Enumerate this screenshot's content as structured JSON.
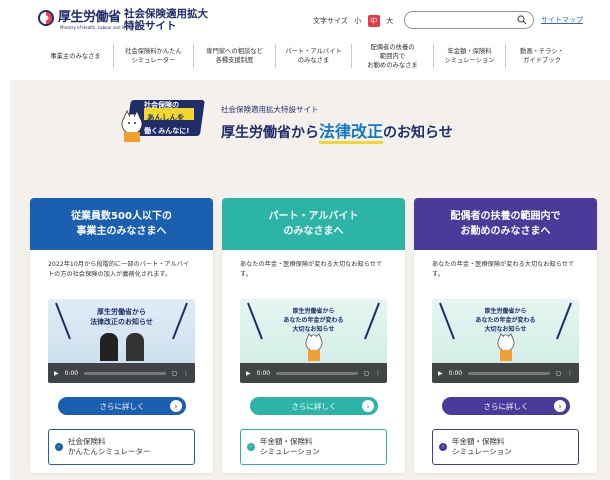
{
  "header": {
    "logo_text": "厚生労働省",
    "logo_sub": "Ministry of Health, Labour and Welfare",
    "site_title": "社会保険適用拡大特設サイト",
    "fontsize_label": "文字サイズ",
    "fontsize_options": [
      "小",
      "中",
      "大"
    ],
    "search_placeholder": "",
    "sitemap": "サイトマップ"
  },
  "nav": [
    "事業主のみなさま",
    "社会保険料かんたん\nシミュレーター",
    "専門家への相談など\n各種支援制度",
    "パート・アルバイト\nのみなさま",
    "配偶者の扶養の\n範囲内で\nお勤めのみなさま",
    "年金額・保険料\nシミュレーション",
    "動画・チラシ・\nガイドブック"
  ],
  "hero": {
    "badge_line1": "社会保険の",
    "badge_line2": "あんしんを",
    "badge_line3": "働くみんなに!",
    "subtitle": "社会保険適用拡大特設サイト",
    "title_pre": "厚生労働省から",
    "title_hl": "法律改正",
    "title_post": "のお知らせ"
  },
  "cards": [
    {
      "title": "従業員数500人以下の\n事業主のみなさまへ",
      "color": "#1b5fb0",
      "desc": "2022年10月から段階的に一部のパート・アルバイトの方の社会保険の加入が義務化されます。",
      "video_text": "厚生労働省から\n法律改正のお知らせ",
      "video_time": "0:00",
      "more": "さらに詳しく",
      "link": "社会保険料\nかんたんシミュレーター"
    },
    {
      "title": "パート・アルバイト\nのみなさまへ",
      "color": "#2cb5a6",
      "desc": "あなたの年金・医療保険が変わる大切なお知らせです。",
      "video_text": "厚生労働省から\nあなたの年金が変わる\n大切なお知らせ",
      "video_time": "0:00",
      "more": "さらに詳しく",
      "link": "年金額・保険料\nシミュレーション"
    },
    {
      "title": "配偶者の扶養の範囲内で\nお勤めのみなさまへ",
      "color": "#4a3a9a",
      "desc": "あなたの年金・医療保険が変わる大切なお知らせです。",
      "video_text": "厚生労働省から\nあなたの年金が変わる\n大切なお知らせ",
      "video_time": "0:00",
      "more": "さらに詳しく",
      "link": "年金額・保険料\nシミュレーション"
    }
  ]
}
